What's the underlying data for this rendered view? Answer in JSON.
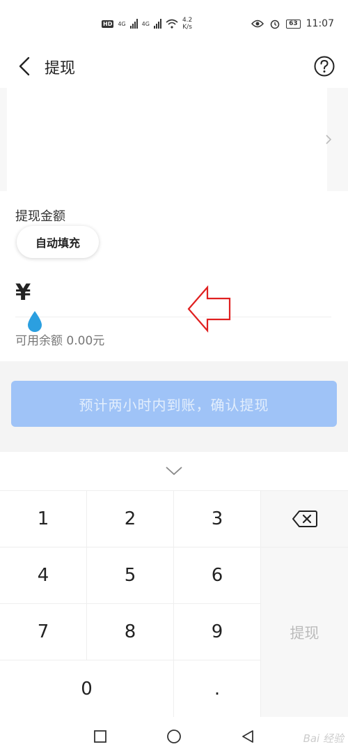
{
  "status_bar": {
    "network_speed_value": "4.2",
    "network_speed_unit": "K/s",
    "battery": "63",
    "time": "11:07",
    "hd_badge": "HD",
    "net_1": "4G",
    "net_2": "4G"
  },
  "header": {
    "title": "提现"
  },
  "amount": {
    "label": "提现金额",
    "autofill_label": "自动填充",
    "currency_symbol": "¥",
    "value": "",
    "balance_text": "可用余额 0.00元"
  },
  "confirm": {
    "label": "预计两小时内到账，确认提现"
  },
  "keypad": {
    "keys": [
      "1",
      "2",
      "3",
      "4",
      "5",
      "6",
      "7",
      "8",
      "9",
      "0",
      "."
    ],
    "submit_label": "提现"
  },
  "watermark": "Bai 经验",
  "colors": {
    "confirm_disabled": "#9fc3f7",
    "cursor_drop": "#2b9fe0",
    "annotation_arrow": "#e02020"
  },
  "icons": {
    "back": "chevron-left-icon",
    "help": "question-circle-icon",
    "card_chevron": "chevron-right-icon",
    "collapse": "chevron-down-icon",
    "delete": "backspace-icon",
    "nav": [
      "square-icon",
      "circle-icon",
      "triangle-back-icon"
    ]
  }
}
